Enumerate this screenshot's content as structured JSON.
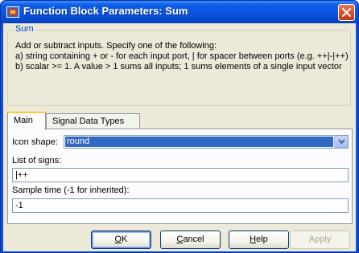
{
  "window": {
    "title": "Function Block Parameters: Sum"
  },
  "group": {
    "title": "Sum",
    "description": [
      "Add or subtract inputs.  Specify one of the following:",
      "a) string containing + or - for each input port, | for spacer between ports (e.g. ++|-|++)",
      "b) scalar >= 1. A value > 1 sums all inputs; 1 sums elements of a single input vector"
    ]
  },
  "tabs": [
    {
      "label": "Main",
      "active": true
    },
    {
      "label": "Signal Data Types",
      "active": false
    }
  ],
  "params": {
    "icon_shape_label": "Icon shape:",
    "icon_shape_value": "round",
    "signs_label": "List of signs:",
    "signs_value": "|++",
    "sample_time_label": "Sample time (-1 for inherited):",
    "sample_time_value": "-1"
  },
  "buttons": {
    "ok": {
      "label": "OK",
      "mnemonic": "O",
      "rest": "K"
    },
    "cancel": {
      "label": "Cancel",
      "mnemonic": "C",
      "rest": "ancel"
    },
    "help": {
      "label": "Help",
      "mnemonic": "H",
      "rest": "elp"
    },
    "apply": {
      "label": "Apply",
      "disabled": true
    }
  },
  "colors": {
    "titlebar": "#0a55e0",
    "group_title": "#0046d5",
    "selection": "#316ac5",
    "tab_highlight": "#ffc83c"
  },
  "icons": {
    "app": "simulink-block-icon",
    "close": "close-icon",
    "dropdown": "chevron-down-icon"
  }
}
